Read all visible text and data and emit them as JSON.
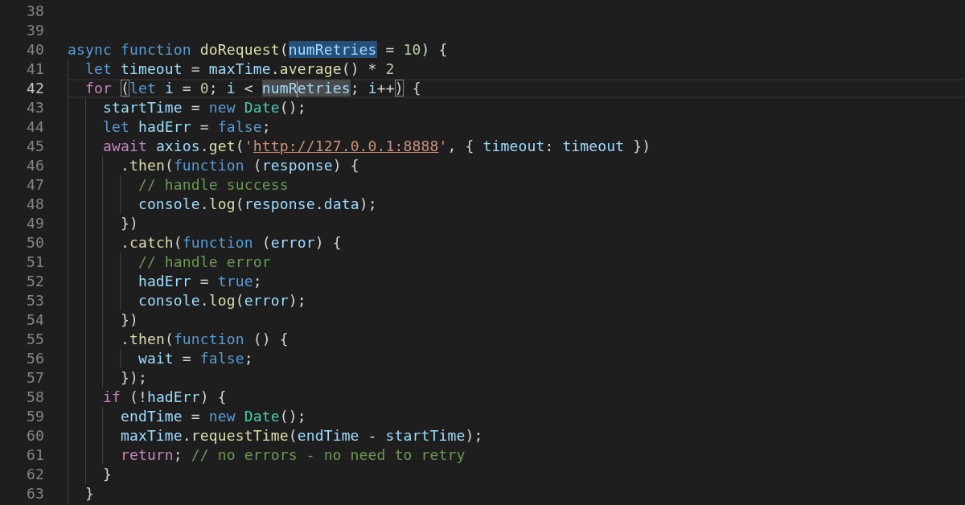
{
  "editor": {
    "lines": [
      {
        "number": "38",
        "current": false
      },
      {
        "number": "39",
        "current": false
      },
      {
        "number": "40",
        "current": false,
        "tokens": [
          {
            "text": "async ",
            "kind": "kw"
          },
          {
            "text": "function ",
            "kind": "kw"
          },
          {
            "text": "doRequest",
            "kind": "fn"
          },
          {
            "text": "(",
            "kind": "plain"
          },
          {
            "text": "numRetries",
            "kind": "var",
            "selected": true
          },
          {
            "text": " = ",
            "kind": "plain"
          },
          {
            "text": "10",
            "kind": "num"
          },
          {
            "text": ") {",
            "kind": "plain"
          }
        ]
      },
      {
        "number": "41",
        "current": false,
        "tokens": [
          {
            "text": "  let ",
            "kind": "kw"
          },
          {
            "text": "timeout",
            "kind": "var"
          },
          {
            "text": " = ",
            "kind": "plain"
          },
          {
            "text": "maxTime",
            "kind": "var"
          },
          {
            "text": ".",
            "kind": "plain"
          },
          {
            "text": "average",
            "kind": "fn"
          },
          {
            "text": "() * ",
            "kind": "plain"
          },
          {
            "text": "2",
            "kind": "num"
          }
        ]
      },
      {
        "number": "42",
        "current": true,
        "tokens": [
          {
            "text": "  for ",
            "kind": "ctrl"
          },
          {
            "text": "(",
            "kind": "plain",
            "bracket_match": true
          },
          {
            "text": "let ",
            "kind": "kw"
          },
          {
            "text": "i",
            "kind": "var"
          },
          {
            "text": " = ",
            "kind": "plain"
          },
          {
            "text": "0",
            "kind": "num"
          },
          {
            "text": "; ",
            "kind": "plain"
          },
          {
            "text": "i",
            "kind": "var"
          },
          {
            "text": " < ",
            "kind": "plain"
          },
          {
            "text": "numR",
            "kind": "var",
            "occurrence_highlight": true,
            "cursor_after": true
          },
          {
            "text": "etries",
            "kind": "var",
            "occurrence_highlight": true
          },
          {
            "text": "; ",
            "kind": "plain"
          },
          {
            "text": "i",
            "kind": "var"
          },
          {
            "text": "++",
            "kind": "plain"
          },
          {
            "text": ")",
            "kind": "plain",
            "bracket_match": true
          },
          {
            "text": " {",
            "kind": "plain"
          }
        ]
      },
      {
        "number": "43",
        "current": false,
        "tokens": [
          {
            "text": "    startTime",
            "kind": "var"
          },
          {
            "text": " = ",
            "kind": "plain"
          },
          {
            "text": "new ",
            "kind": "kw"
          },
          {
            "text": "Date",
            "kind": "cls"
          },
          {
            "text": "();",
            "kind": "plain"
          }
        ]
      },
      {
        "number": "44",
        "current": false,
        "tokens": [
          {
            "text": "    let ",
            "kind": "kw"
          },
          {
            "text": "hadErr",
            "kind": "var"
          },
          {
            "text": " = ",
            "kind": "plain"
          },
          {
            "text": "false",
            "kind": "kw"
          },
          {
            "text": ";",
            "kind": "plain"
          }
        ]
      },
      {
        "number": "45",
        "current": false,
        "tokens": [
          {
            "text": "    await ",
            "kind": "ctrl"
          },
          {
            "text": "axios",
            "kind": "var"
          },
          {
            "text": ".",
            "kind": "plain"
          },
          {
            "text": "get",
            "kind": "fn"
          },
          {
            "text": "(",
            "kind": "plain"
          },
          {
            "text": "'",
            "kind": "str"
          },
          {
            "text": "http://127.0.0.1:8888",
            "kind": "str",
            "link": true
          },
          {
            "text": "'",
            "kind": "str"
          },
          {
            "text": ", { ",
            "kind": "plain"
          },
          {
            "text": "timeout",
            "kind": "var"
          },
          {
            "text": ": ",
            "kind": "plain"
          },
          {
            "text": "timeout",
            "kind": "var"
          },
          {
            "text": " })",
            "kind": "plain"
          }
        ]
      },
      {
        "number": "46",
        "current": false,
        "tokens": [
          {
            "text": "      .",
            "kind": "plain"
          },
          {
            "text": "then",
            "kind": "fn"
          },
          {
            "text": "(",
            "kind": "plain"
          },
          {
            "text": "function",
            "kind": "kw"
          },
          {
            "text": " (",
            "kind": "plain"
          },
          {
            "text": "response",
            "kind": "var"
          },
          {
            "text": ") {",
            "kind": "plain"
          }
        ]
      },
      {
        "number": "47",
        "current": false,
        "tokens": [
          {
            "text": "        // handle success",
            "kind": "com"
          }
        ]
      },
      {
        "number": "48",
        "current": false,
        "tokens": [
          {
            "text": "        console",
            "kind": "var"
          },
          {
            "text": ".",
            "kind": "plain"
          },
          {
            "text": "log",
            "kind": "fn"
          },
          {
            "text": "(",
            "kind": "plain"
          },
          {
            "text": "response",
            "kind": "var"
          },
          {
            "text": ".",
            "kind": "plain"
          },
          {
            "text": "data",
            "kind": "var"
          },
          {
            "text": ");",
            "kind": "plain"
          }
        ]
      },
      {
        "number": "49",
        "current": false,
        "tokens": [
          {
            "text": "      })",
            "kind": "plain"
          }
        ]
      },
      {
        "number": "50",
        "current": false,
        "tokens": [
          {
            "text": "      .",
            "kind": "plain"
          },
          {
            "text": "catch",
            "kind": "fn"
          },
          {
            "text": "(",
            "kind": "plain"
          },
          {
            "text": "function",
            "kind": "kw"
          },
          {
            "text": " (",
            "kind": "plain"
          },
          {
            "text": "error",
            "kind": "var"
          },
          {
            "text": ") {",
            "kind": "plain"
          }
        ]
      },
      {
        "number": "51",
        "current": false,
        "tokens": [
          {
            "text": "        // handle error",
            "kind": "com"
          }
        ]
      },
      {
        "number": "52",
        "current": false,
        "tokens": [
          {
            "text": "        hadErr",
            "kind": "var"
          },
          {
            "text": " = ",
            "kind": "plain"
          },
          {
            "text": "true",
            "kind": "kw"
          },
          {
            "text": ";",
            "kind": "plain"
          }
        ]
      },
      {
        "number": "53",
        "current": false,
        "tokens": [
          {
            "text": "        console",
            "kind": "var"
          },
          {
            "text": ".",
            "kind": "plain"
          },
          {
            "text": "log",
            "kind": "fn"
          },
          {
            "text": "(",
            "kind": "plain"
          },
          {
            "text": "error",
            "kind": "var"
          },
          {
            "text": ");",
            "kind": "plain"
          }
        ]
      },
      {
        "number": "54",
        "current": false,
        "tokens": [
          {
            "text": "      })",
            "kind": "plain"
          }
        ]
      },
      {
        "number": "55",
        "current": false,
        "tokens": [
          {
            "text": "      .",
            "kind": "plain"
          },
          {
            "text": "then",
            "kind": "fn"
          },
          {
            "text": "(",
            "kind": "plain"
          },
          {
            "text": "function",
            "kind": "kw"
          },
          {
            "text": " () {",
            "kind": "plain"
          }
        ]
      },
      {
        "number": "56",
        "current": false,
        "tokens": [
          {
            "text": "        wait",
            "kind": "var"
          },
          {
            "text": " = ",
            "kind": "plain"
          },
          {
            "text": "false",
            "kind": "kw"
          },
          {
            "text": ";",
            "kind": "plain"
          }
        ]
      },
      {
        "number": "57",
        "current": false,
        "tokens": [
          {
            "text": "      });",
            "kind": "plain"
          }
        ]
      },
      {
        "number": "58",
        "current": false,
        "tokens": [
          {
            "text": "    if",
            "kind": "ctrl"
          },
          {
            "text": " (!",
            "kind": "plain"
          },
          {
            "text": "hadErr",
            "kind": "var"
          },
          {
            "text": ") {",
            "kind": "plain"
          }
        ]
      },
      {
        "number": "59",
        "current": false,
        "tokens": [
          {
            "text": "      endTime",
            "kind": "var"
          },
          {
            "text": " = ",
            "kind": "plain"
          },
          {
            "text": "new ",
            "kind": "kw"
          },
          {
            "text": "Date",
            "kind": "cls"
          },
          {
            "text": "();",
            "kind": "plain"
          }
        ]
      },
      {
        "number": "60",
        "current": false,
        "tokens": [
          {
            "text": "      maxTime",
            "kind": "var"
          },
          {
            "text": ".",
            "kind": "plain"
          },
          {
            "text": "requestTime",
            "kind": "fn"
          },
          {
            "text": "(",
            "kind": "plain"
          },
          {
            "text": "endTime",
            "kind": "var"
          },
          {
            "text": " - ",
            "kind": "plain"
          },
          {
            "text": "startTime",
            "kind": "var"
          },
          {
            "text": ");",
            "kind": "plain"
          }
        ]
      },
      {
        "number": "61",
        "current": false,
        "tokens": [
          {
            "text": "      return",
            "kind": "ctrl"
          },
          {
            "text": "; ",
            "kind": "plain"
          },
          {
            "text": "// no errors - no need to retry",
            "kind": "com"
          }
        ]
      },
      {
        "number": "62",
        "current": false,
        "tokens": [
          {
            "text": "    }",
            "kind": "plain"
          }
        ]
      },
      {
        "number": "63",
        "current": false,
        "tokens": [
          {
            "text": "  }",
            "kind": "plain"
          }
        ]
      }
    ]
  }
}
